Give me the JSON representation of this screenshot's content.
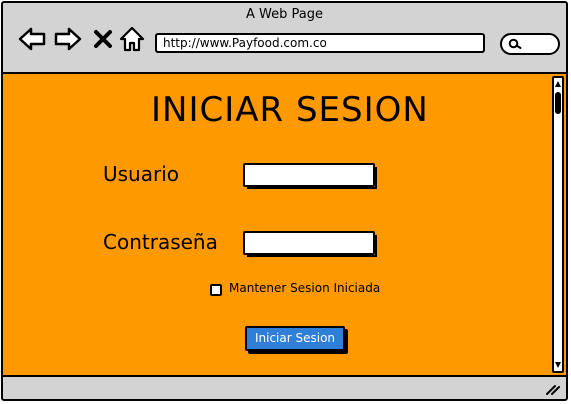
{
  "browser": {
    "title": "A Web Page",
    "url": "http://www.Payfood.com.co",
    "icons": {
      "back": "arrow-left-icon",
      "forward": "arrow-right-icon",
      "stop": "close-icon",
      "home": "home-icon",
      "search": "search-icon",
      "resize": "resize-grip-icon"
    }
  },
  "login": {
    "heading": "INICIAR SESION",
    "username_label": "Usuario",
    "username_value": "",
    "password_label": "Contraseña",
    "password_value": "",
    "remember_label": "Mantener Sesion Iniciada",
    "remember_checked": false,
    "submit_label": "Iniciar Sesion"
  },
  "colors": {
    "page_background": "#ff9900",
    "chrome": "#d3d3d3",
    "button": "#2f7fd8"
  }
}
